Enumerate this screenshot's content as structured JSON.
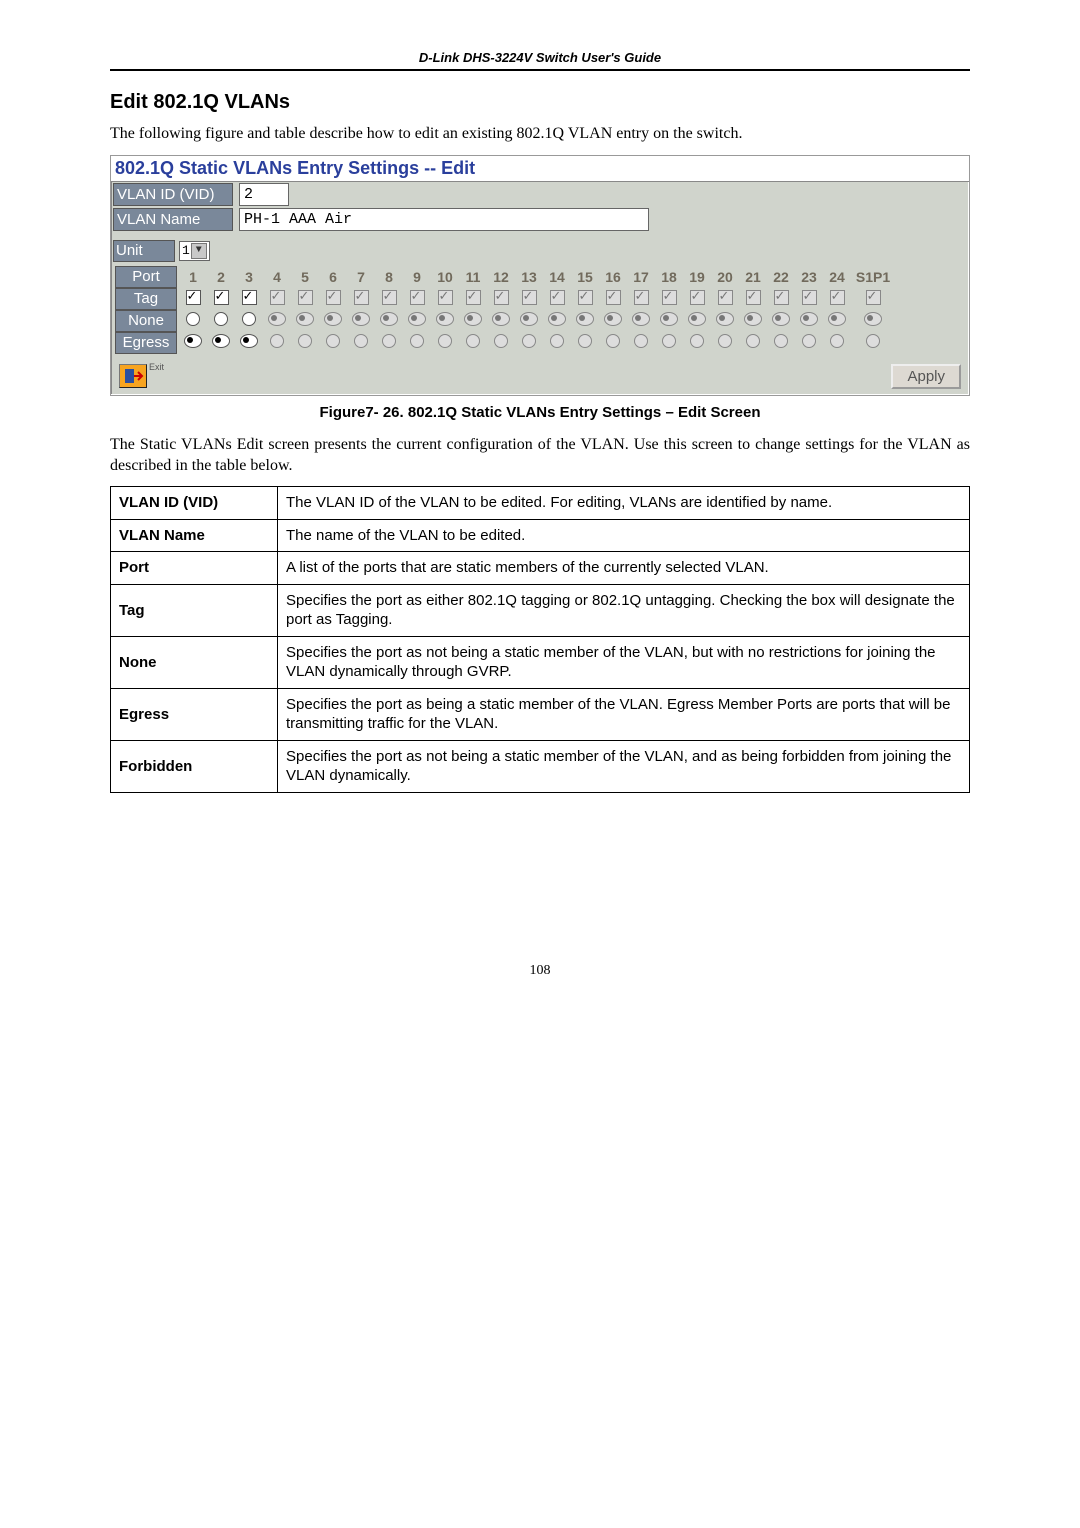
{
  "header": "D-Link DHS-3224V Switch User's Guide",
  "section_title": "Edit 802.1Q VLANs",
  "intro": "The following figure and table describe how to edit an existing 802.1Q VLAN entry on the switch.",
  "screenshot": {
    "title": "802.1Q Static VLANs Entry Settings -- Edit",
    "vid_label": "VLAN ID (VID)",
    "vid_value": "2",
    "name_label": "VLAN Name",
    "name_value": "PH-1 AAA Air",
    "unit_label": "Unit",
    "unit_value": "1",
    "port_label": "Port",
    "tag_label": "Tag",
    "none_label": "None",
    "egress_label": "Egress",
    "port_headers": [
      "1",
      "2",
      "3",
      "4",
      "5",
      "6",
      "7",
      "8",
      "9",
      "10",
      "11",
      "12",
      "13",
      "14",
      "15",
      "16",
      "17",
      "18",
      "19",
      "20",
      "21",
      "22",
      "23",
      "24",
      "S1P1"
    ],
    "tag_row": [
      {
        "checked": true,
        "disabled": false
      },
      {
        "checked": true,
        "disabled": false
      },
      {
        "checked": true,
        "disabled": false
      },
      {
        "checked": true,
        "disabled": true
      },
      {
        "checked": true,
        "disabled": true
      },
      {
        "checked": true,
        "disabled": true
      },
      {
        "checked": true,
        "disabled": true
      },
      {
        "checked": true,
        "disabled": true
      },
      {
        "checked": true,
        "disabled": true
      },
      {
        "checked": true,
        "disabled": true
      },
      {
        "checked": true,
        "disabled": true
      },
      {
        "checked": true,
        "disabled": true
      },
      {
        "checked": true,
        "disabled": true
      },
      {
        "checked": true,
        "disabled": true
      },
      {
        "checked": true,
        "disabled": true
      },
      {
        "checked": true,
        "disabled": true
      },
      {
        "checked": true,
        "disabled": true
      },
      {
        "checked": true,
        "disabled": true
      },
      {
        "checked": true,
        "disabled": true
      },
      {
        "checked": true,
        "disabled": true
      },
      {
        "checked": true,
        "disabled": true
      },
      {
        "checked": true,
        "disabled": true
      },
      {
        "checked": true,
        "disabled": true
      },
      {
        "checked": true,
        "disabled": true
      },
      {
        "checked": true,
        "disabled": true
      }
    ],
    "radio_rows": {
      "none": [
        {
          "sel": false,
          "dis": false
        },
        {
          "sel": false,
          "dis": false
        },
        {
          "sel": false,
          "dis": false
        },
        {
          "sel": true,
          "dis": true
        },
        {
          "sel": true,
          "dis": true
        },
        {
          "sel": true,
          "dis": true
        },
        {
          "sel": true,
          "dis": true
        },
        {
          "sel": true,
          "dis": true
        },
        {
          "sel": true,
          "dis": true
        },
        {
          "sel": true,
          "dis": true
        },
        {
          "sel": true,
          "dis": true
        },
        {
          "sel": true,
          "dis": true
        },
        {
          "sel": true,
          "dis": true
        },
        {
          "sel": true,
          "dis": true
        },
        {
          "sel": true,
          "dis": true
        },
        {
          "sel": true,
          "dis": true
        },
        {
          "sel": true,
          "dis": true
        },
        {
          "sel": true,
          "dis": true
        },
        {
          "sel": true,
          "dis": true
        },
        {
          "sel": true,
          "dis": true
        },
        {
          "sel": true,
          "dis": true
        },
        {
          "sel": true,
          "dis": true
        },
        {
          "sel": true,
          "dis": true
        },
        {
          "sel": true,
          "dis": true
        },
        {
          "sel": true,
          "dis": true
        }
      ],
      "egress": [
        {
          "sel": true,
          "dis": false
        },
        {
          "sel": true,
          "dis": false
        },
        {
          "sel": true,
          "dis": false
        },
        {
          "sel": false,
          "dis": true
        },
        {
          "sel": false,
          "dis": true
        },
        {
          "sel": false,
          "dis": true
        },
        {
          "sel": false,
          "dis": true
        },
        {
          "sel": false,
          "dis": true
        },
        {
          "sel": false,
          "dis": true
        },
        {
          "sel": false,
          "dis": true
        },
        {
          "sel": false,
          "dis": true
        },
        {
          "sel": false,
          "dis": true
        },
        {
          "sel": false,
          "dis": true
        },
        {
          "sel": false,
          "dis": true
        },
        {
          "sel": false,
          "dis": true
        },
        {
          "sel": false,
          "dis": true
        },
        {
          "sel": false,
          "dis": true
        },
        {
          "sel": false,
          "dis": true
        },
        {
          "sel": false,
          "dis": true
        },
        {
          "sel": false,
          "dis": true
        },
        {
          "sel": false,
          "dis": true
        },
        {
          "sel": false,
          "dis": true
        },
        {
          "sel": false,
          "dis": true
        },
        {
          "sel": false,
          "dis": true
        },
        {
          "sel": false,
          "dis": true
        }
      ]
    },
    "exit_label": "Exit",
    "apply_label": "Apply"
  },
  "caption": "Figure7- 26.  802.1Q Static VLANs Entry Settings – Edit Screen",
  "para2": "The Static VLANs Edit screen presents the current configuration of the VLAN. Use this screen to change settings for the VLAN as described in the table below.",
  "desc_table": [
    {
      "term": "VLAN ID (VID)",
      "def": "The VLAN ID of the VLAN to be edited.  For editing, VLANs are identified by name."
    },
    {
      "term": "VLAN Name",
      "def": "The name of the VLAN to be edited."
    },
    {
      "term": "Port",
      "def": "A list of the ports that are static members of the currently selected VLAN."
    },
    {
      "term": "Tag",
      "def": "Specifies the port as either 802.1Q tagging or 802.1Q untagging.  Checking the box will designate the port as Tagging."
    },
    {
      "term": "None",
      "def": "Specifies the port as not being a static member of the VLAN, but with no restrictions for joining the VLAN dynamically through GVRP."
    },
    {
      "term": "Egress",
      "def": "Specifies the port as being a static member of the VLAN.  Egress Member Ports are ports that will be transmitting traffic for the VLAN."
    },
    {
      "term": "Forbidden",
      "def": "Specifies the port as not being a static member of the VLAN, and as being forbidden from joining the VLAN dynamically."
    }
  ],
  "page_number": "108"
}
